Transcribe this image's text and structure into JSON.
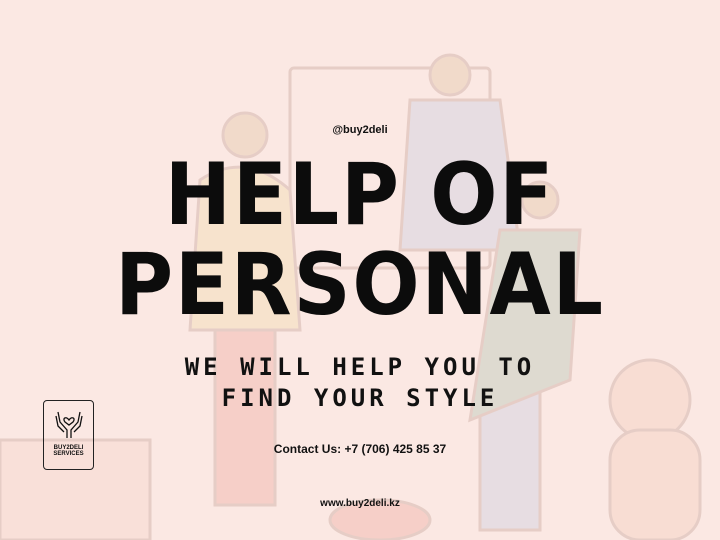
{
  "handle": "@buy2deli",
  "title": {
    "line1": "HELP OF",
    "line2": "PERSONAL"
  },
  "subtitle": {
    "line1": "WE WILL HELP YOU TO",
    "line2": "FIND YOUR STYLE"
  },
  "contact": "Contact Us: +7 (706) 425 85 37",
  "website": "www.buy2deli.kz",
  "logo": {
    "icon": "hands-heart-icon",
    "line1": "BUY2DELI",
    "line2": "SERVICES"
  },
  "colors": {
    "background": "#fbe8e3",
    "text": "#0c0c0c"
  }
}
